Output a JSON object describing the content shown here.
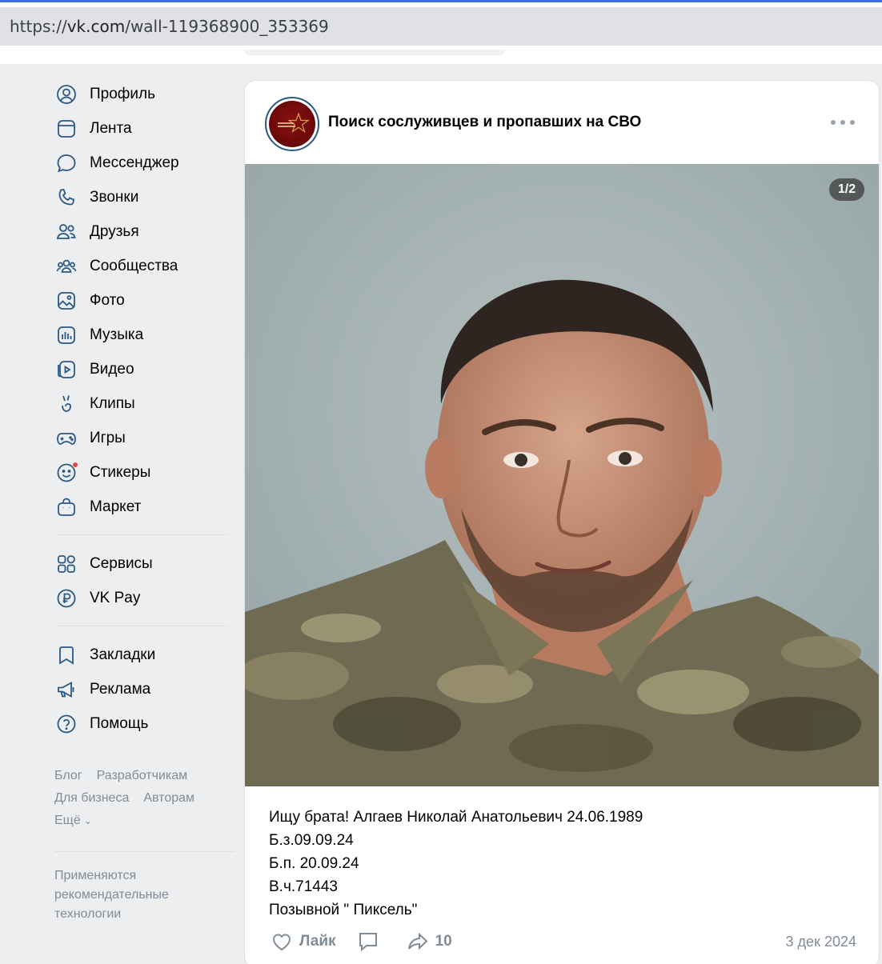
{
  "browser": {
    "url_prefix": "https://",
    "url_host": "vk.com",
    "url_path": "/wall-119368900_353369"
  },
  "sidebar": {
    "items": [
      {
        "label": "Профиль",
        "icon": "user-circle-icon"
      },
      {
        "label": "Лента",
        "icon": "feed-icon"
      },
      {
        "label": "Мессенджер",
        "icon": "message-icon"
      },
      {
        "label": "Звонки",
        "icon": "phone-icon"
      },
      {
        "label": "Друзья",
        "icon": "friends-icon"
      },
      {
        "label": "Сообщества",
        "icon": "communities-icon"
      },
      {
        "label": "Фото",
        "icon": "photo-icon"
      },
      {
        "label": "Музыка",
        "icon": "music-icon"
      },
      {
        "label": "Видео",
        "icon": "video-icon"
      },
      {
        "label": "Клипы",
        "icon": "clips-icon"
      },
      {
        "label": "Игры",
        "icon": "gamepad-icon"
      },
      {
        "label": "Стикеры",
        "icon": "sticker-icon"
      },
      {
        "label": "Маркет",
        "icon": "market-bag-icon"
      }
    ],
    "secondary": [
      {
        "label": "Сервисы",
        "icon": "services-grid-icon"
      },
      {
        "label": "VK Pay",
        "icon": "vkpay-ruble-icon"
      }
    ],
    "tertiary": [
      {
        "label": "Закладки",
        "icon": "bookmark-icon"
      },
      {
        "label": "Реклама",
        "icon": "megaphone-icon"
      },
      {
        "label": "Помощь",
        "icon": "help-icon"
      }
    ],
    "footer": {
      "blog": "Блог",
      "developers": "Разработчикам",
      "business": "Для бизнеса",
      "authors": "Авторам",
      "more": "Ещё",
      "note": "Применяются рекомендательные технологии"
    }
  },
  "post": {
    "group_name": "Поиск сослуживцев и пропавших на СВО",
    "photo_counter": "1/2",
    "text": "Ищу брата! Алгаев Николай Анатольевич 24.06.1989\nБ.з.09.09.24\nБ.п. 20.09.24\nВ.ч.71443\nПозывной \" Пиксель\"",
    "like_label": "Лайк",
    "shares": "10",
    "date": "3 дек 2024"
  },
  "colors": {
    "accent": "#2a5885",
    "muted": "#818c99",
    "page_bg": "#edeef0",
    "badge": "#e64646"
  }
}
